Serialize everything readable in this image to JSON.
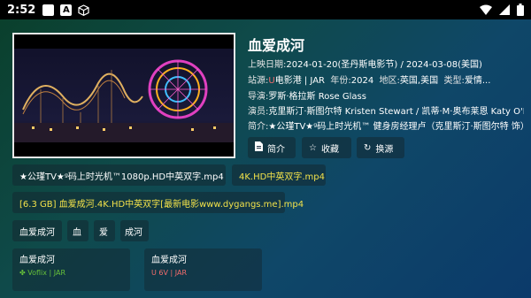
{
  "status_bar": {
    "time": "2:52"
  },
  "movie": {
    "title": "血爱成河",
    "release_label": "上映日期:",
    "release_value": "2024-01-20(圣丹斯电影节) / 2024-03-08(美国)",
    "source_label": "站源:",
    "source_value": "电影港 | JAR",
    "year_label": "年份:",
    "year_value": "2024",
    "region_label": "地区:",
    "region_value": "英国,美国",
    "type_label": "类型:",
    "type_value": "爱情...",
    "director_label": "导演:",
    "director_value": "罗斯·格拉斯 Rose Glass",
    "cast_label": "演员:",
    "cast_value": "克里斯汀·斯图尔特 Kristen Stewart / 凯蒂·M·奥布莱恩 Katy O'Brian",
    "summary_label": "简介:",
    "summary_value": "★公瑾TV★ᵍ码上时光机™      健身房经理卢（克里斯汀·斯图尔特 饰）"
  },
  "actions": {
    "intro": "简介",
    "favorite": "收藏",
    "switch_source": "换源"
  },
  "episodes": [
    "★公瑾TV★ᵍ码上时光机™1080p.HD中英双字.mp4",
    "4K.HD中英双字.mp4",
    "[6.3 GB] 血爱成河.4K.HD中英双字[最新电影www.dygangs.me].mp4"
  ],
  "tags": [
    "血爱成河",
    "血",
    "爱",
    "成河"
  ],
  "cards": [
    {
      "title": "血爱成河",
      "source": "Voflix | JAR",
      "color": "#67c23a"
    },
    {
      "title": "血爱成河",
      "source": "6V | JAR",
      "color": "#f56c6c"
    }
  ]
}
